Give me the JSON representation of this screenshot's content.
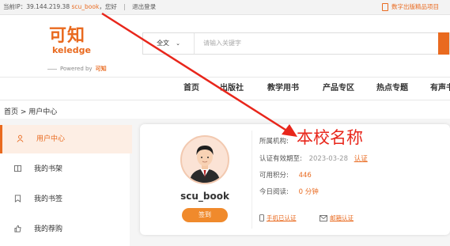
{
  "topbar": {
    "ip_prefix": "当前IP：39.144.219.38",
    "username": "scu_book",
    "greeting": "，您好",
    "separator": "|",
    "logout": "退出登录",
    "right_link": "数字出版精品项目"
  },
  "logo": {
    "title": "可知",
    "subtitle": "keledge",
    "powered_prefix": "Powered by",
    "powered_brand": "可知"
  },
  "search": {
    "scope": "全文",
    "placeholder": "请输入关键字"
  },
  "nav": [
    "首页",
    "出版社",
    "教学用书",
    "产品专区",
    "热点专题",
    "有声书"
  ],
  "breadcrumb": "首页 > 用户中心",
  "sidebar": [
    {
      "label": "用户中心",
      "icon": "user-icon",
      "active": true
    },
    {
      "label": "我的书架",
      "icon": "book-icon",
      "active": false
    },
    {
      "label": "我的书签",
      "icon": "bookmark-icon",
      "active": false
    },
    {
      "label": "我的荐购",
      "icon": "recommend-icon",
      "active": false
    }
  ],
  "profile": {
    "username": "scu_book",
    "signin_button": "签到",
    "institution_label": "所属机构:",
    "institution_value": "本校名称",
    "expiry_label": "认证有效期至:",
    "expiry_date": "2023-03-28",
    "expiry_action": "认证",
    "points_label": "可用积分:",
    "points_value": "446",
    "reading_label": "今日阅读:",
    "reading_value": "0 分钟",
    "phone_verified": "手机已认证",
    "email_verify": "邮箱认证"
  },
  "colors": {
    "accent": "#e96a1f",
    "institution_text": "#e8261b",
    "arrow": "#e8261b"
  }
}
